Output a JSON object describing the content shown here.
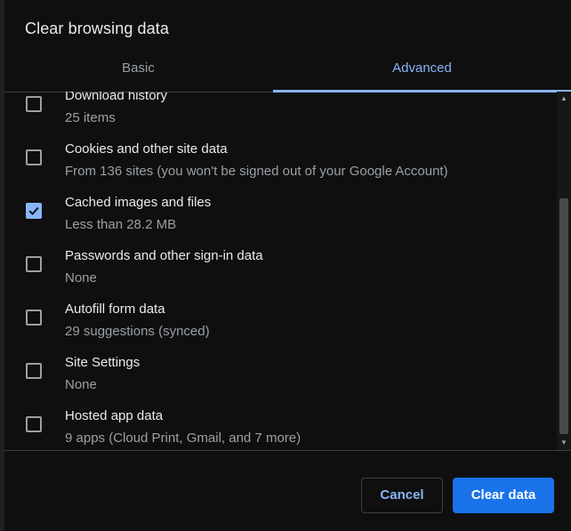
{
  "dialog": {
    "title": "Clear browsing data"
  },
  "tabs": [
    {
      "label": "Basic",
      "selected": false
    },
    {
      "label": "Advanced",
      "selected": true
    }
  ],
  "items": [
    {
      "label": "Download history",
      "sub": "25 items",
      "checked": false
    },
    {
      "label": "Cookies and other site data",
      "sub": "From 136 sites (you won't be signed out of your Google Account)",
      "checked": false
    },
    {
      "label": "Cached images and files",
      "sub": "Less than 28.2 MB",
      "checked": true
    },
    {
      "label": "Passwords and other sign-in data",
      "sub": "None",
      "checked": false
    },
    {
      "label": "Autofill form data",
      "sub": "29 suggestions (synced)",
      "checked": false
    },
    {
      "label": "Site Settings",
      "sub": "None",
      "checked": false
    },
    {
      "label": "Hosted app data",
      "sub": "9 apps (Cloud Print, Gmail, and 7 more)",
      "checked": false
    }
  ],
  "buttons": {
    "cancel": "Cancel",
    "clear": "Clear data"
  },
  "colors": {
    "accent": "#8ab4f8",
    "primary_button": "#1a73e8",
    "dialog_bg": "#0f0f0f"
  },
  "icons": {
    "check": "check-icon",
    "scroll_up": "scroll-up-arrow-icon",
    "scroll_down": "scroll-down-arrow-icon"
  }
}
